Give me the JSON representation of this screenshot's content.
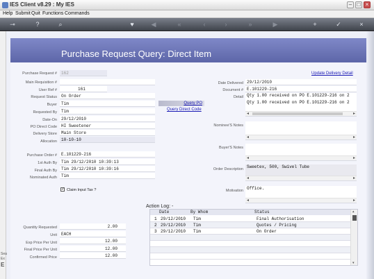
{
  "window": {
    "title": "IES Client v8.29 : My IES"
  },
  "menu": [
    "Help",
    "Submit",
    "Quit",
    "Functions",
    "Commands"
  ],
  "toolbar_icons": [
    "key-icon",
    "help-icon",
    "search-icon",
    "heart-icon",
    "back-icon",
    "rewind-icon",
    "previous-icon",
    "next-icon",
    "fast-forward-icon",
    "end-icon",
    "plus-icon",
    "check-icon",
    "close-icon"
  ],
  "page": {
    "title": "Purchase Request Query: Direct Item"
  },
  "links": {
    "update_delivery": "Update Delivery Detail",
    "query_po": "Query PO",
    "query_direct_code": "Query Direct Code"
  },
  "labels": {
    "purchase_request_no": "Purchase Request #",
    "main_requisition_no": "Main Requisition #",
    "user_ref_no": "User Ref #",
    "request_status": "Request Status",
    "buyer": "Buyer",
    "requested_by": "Requested By",
    "date_on": "Date-On",
    "po_direct_code": "PO Direct Code",
    "delivery_store": "Delivery Store",
    "allocation": "Allocation",
    "purchase_order_no": "Purchase Order #",
    "first_auth_by": "1st Auth By",
    "final_auth_by": "Final Auth By",
    "nominated_auth": "Nominated Auth",
    "claim_input_tax": "Claim Input Tax ?",
    "date_delivered": "Date Delivered",
    "document_no": "Document #",
    "detail": "Detail",
    "nominee_notes": "Nominee'S Notes",
    "buyer_notes": "Buyer'S Notes",
    "order_description": "Order Description",
    "motivation": "Motivation",
    "quantity_requested": "Quantity Requested",
    "unit": "Unit",
    "exp_price_per_unit": "Exp Price Per Unit",
    "final_price_per_unit": "Final Price Per Unit",
    "confirmed_price": "Confirmed Price"
  },
  "values": {
    "purchase_request_no": "162",
    "main_requisition_no": "",
    "user_ref_no": "161",
    "request_status": "On Order",
    "buyer": "Tim",
    "requested_by": "Tim",
    "date_on": "29/12/2010",
    "po_direct_code": "HI Sweetener",
    "delivery_store": "Main Store",
    "allocation": "10-10-10",
    "purchase_order_no": "E.101229-216",
    "first_auth_by": "Tim 29/12/2010 10:39:13",
    "final_auth_by": "Tim 29/12/2010 10:39:16",
    "nominated_auth": "Tim",
    "date_delivered": "29/12/2010",
    "document_no": "E.101229-216",
    "detail_lines": [
      "Qty 1.00 received on PO E.101229-216 on 2",
      "Qty 1.00 received on PO E.101229-216 on 2"
    ],
    "nominee_notes": "",
    "buyer_notes": "",
    "order_description": "Sweetex, 500, Swivel Tube",
    "motivation": "Office.",
    "quantity_requested": "2.00",
    "unit": "EACH",
    "exp_price_per_unit": "12.00",
    "final_price_per_unit": "12.00",
    "confirmed_price": "12.00",
    "claim_input_tax_checked": true
  },
  "action_log": {
    "title": "Action Log: -",
    "columns": [
      "Date",
      "By Whom",
      "Status"
    ],
    "rows": [
      {
        "n": "1",
        "date": "29/12/2010",
        "by": "Tim",
        "status": "Final Authorisation"
      },
      {
        "n": "2",
        "date": "29/12/2010",
        "by": "Tim",
        "status": "Quotes / Pricing"
      },
      {
        "n": "3",
        "date": "29/12/2010",
        "by": "Tim",
        "status": "On Order"
      }
    ]
  },
  "left_strip": [
    "Sea",
    "Ex",
    "E"
  ],
  "colors": {
    "header": "#6c75b8",
    "canvas": "#eef0f8",
    "link": "#1a1ab5",
    "toolbar": "#4a4e57"
  }
}
